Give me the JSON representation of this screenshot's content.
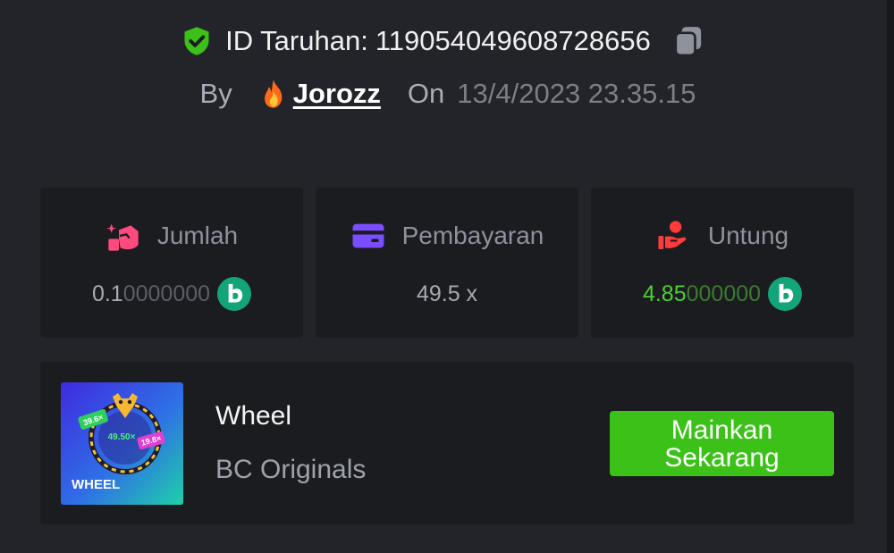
{
  "bet": {
    "id_label": "ID Taruhan:",
    "id_value": "119054049608728656",
    "by_label": "By",
    "username": "Jorozz",
    "on_label": "On",
    "date": "13/4/2023 23.35.15"
  },
  "stats": {
    "amount": {
      "label": "Jumlah",
      "value_strong": "0.1",
      "value_faded": "0000000"
    },
    "payout": {
      "label": "Pembayaran",
      "value": "49.5 x"
    },
    "profit": {
      "label": "Untung",
      "value_strong": "4.85",
      "value_faded": "000000"
    }
  },
  "game": {
    "name": "Wheel",
    "provider": "BC Originals",
    "thumb_title": "WHEEL",
    "thumb_center": "49.50×",
    "thumb_left": "39.6×",
    "thumb_right": "19.8×",
    "play_label": "Mainkan Sekarang"
  },
  "colors": {
    "background": "#232429",
    "card": "#1b1c20",
    "accent_green": "#3bc117",
    "profit_green": "#4bd12f"
  },
  "icons": [
    "shield-check-icon",
    "copy-icon",
    "fire-icon",
    "bet-amount-icon",
    "wallet-card-icon",
    "profit-hand-icon",
    "bc-coin-icon"
  ]
}
